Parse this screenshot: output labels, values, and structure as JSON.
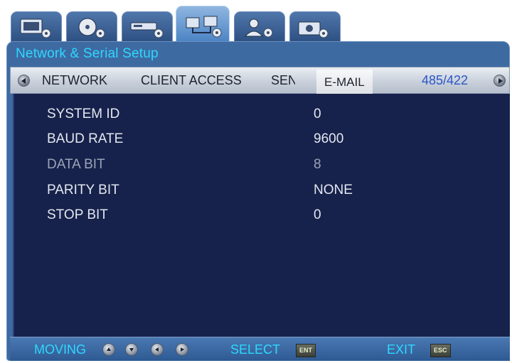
{
  "icon_tabs": [
    {
      "icon": "monitor-settings-icon"
    },
    {
      "icon": "disc-settings-icon"
    },
    {
      "icon": "recorder-settings-icon"
    },
    {
      "icon": "network-settings-icon",
      "active": true
    },
    {
      "icon": "user-settings-icon"
    },
    {
      "icon": "camera-settings-icon"
    }
  ],
  "window": {
    "title": "Network & Serial Setup"
  },
  "subtabs": {
    "network": "NETWORK",
    "client_access": "CLIENT ACCESS",
    "sen": "SEN",
    "email": "E-MAIL",
    "rs485": "485/422"
  },
  "settings": [
    {
      "label": "SYSTEM ID",
      "value": "0"
    },
    {
      "label": "BAUD RATE",
      "value": "9600"
    },
    {
      "label": "DATA BIT",
      "value": "8"
    },
    {
      "label": "PARITY BIT",
      "value": "NONE"
    },
    {
      "label": "STOP BIT",
      "value": "0"
    }
  ],
  "footer": {
    "moving": "MOVING",
    "select": "SELECT",
    "select_key": "ENT",
    "exit": "EXIT",
    "exit_key": "ESC"
  },
  "colors": {
    "accent_cyan": "#2ed8ff",
    "active_tab_text": "#2a57c8",
    "panel_bg": "#16224b"
  }
}
